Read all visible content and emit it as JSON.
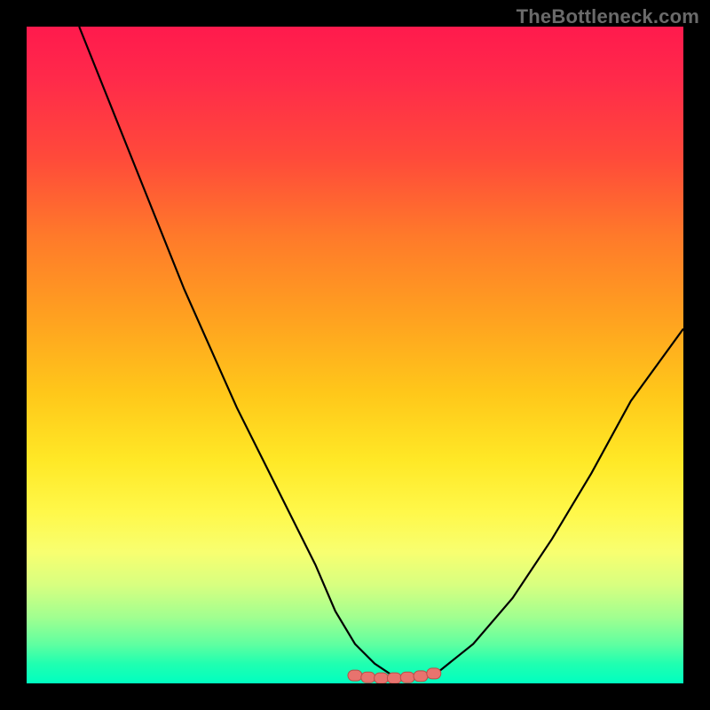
{
  "watermark": "TheBottleneck.com",
  "colors": {
    "frame": "#000000",
    "watermark": "#6a6a6a",
    "line": "#000000",
    "marker_fill": "#e8736e",
    "marker_stroke": "#b84e49"
  },
  "chart_data": {
    "type": "line",
    "title": "",
    "xlabel": "",
    "ylabel": "",
    "xlim": [
      0,
      100
    ],
    "ylim": [
      0,
      100
    ],
    "grid": false,
    "legend": false,
    "background": "gradient red→yellow→green (top→bottom)",
    "series": [
      {
        "name": "bottleneck-curve",
        "x": [
          8,
          12,
          16,
          20,
          24,
          28,
          32,
          36,
          40,
          44,
          47,
          50,
          53,
          56,
          59,
          63,
          68,
          74,
          80,
          86,
          92,
          100
        ],
        "y": [
          100,
          90,
          80,
          70,
          60,
          51,
          42,
          34,
          26,
          18,
          11,
          6,
          3,
          1,
          1,
          2,
          6,
          13,
          22,
          32,
          43,
          54
        ]
      }
    ],
    "markers": {
      "name": "highlight-band",
      "x": [
        50,
        52,
        54,
        56,
        58,
        60,
        62
      ],
      "y": [
        1.2,
        0.9,
        0.8,
        0.8,
        0.9,
        1.1,
        1.5
      ]
    }
  }
}
